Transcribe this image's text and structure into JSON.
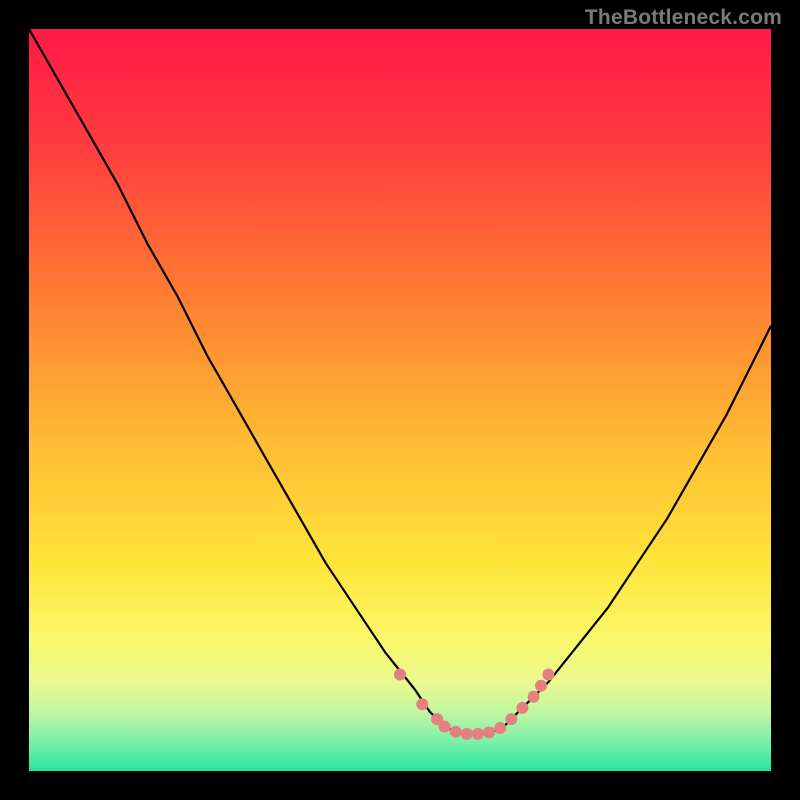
{
  "watermark": "TheBottleneck.com",
  "chart_data": {
    "type": "line",
    "title": "",
    "xlabel": "",
    "ylabel": "",
    "xlim": [
      0,
      100
    ],
    "ylim": [
      0,
      100
    ],
    "grid": false,
    "axes_visible": false,
    "background_gradient": {
      "stops": [
        {
          "offset": 0,
          "color": "#ff1a47"
        },
        {
          "offset": 15,
          "color": "#ff3a3f"
        },
        {
          "offset": 35,
          "color": "#ff7a33"
        },
        {
          "offset": 55,
          "color": "#ffb933"
        },
        {
          "offset": 72,
          "color": "#ffe43a"
        },
        {
          "offset": 82,
          "color": "#fbf86a"
        },
        {
          "offset": 88,
          "color": "#eaf98f"
        },
        {
          "offset": 92,
          "color": "#c1f7a0"
        },
        {
          "offset": 96,
          "color": "#7cf0ab"
        },
        {
          "offset": 100,
          "color": "#23e59e"
        }
      ]
    },
    "series": [
      {
        "name": "bottleneck-curve",
        "color": "#000000",
        "x": [
          0,
          4,
          8,
          12,
          16,
          20,
          24,
          28,
          32,
          36,
          40,
          44,
          48,
          52,
          54,
          56,
          58,
          60,
          62,
          64,
          66,
          70,
          74,
          78,
          82,
          86,
          90,
          94,
          98,
          100
        ],
        "y": [
          100,
          93,
          86,
          79,
          71,
          64,
          56,
          49,
          42,
          35,
          28,
          22,
          16,
          11,
          8,
          6,
          5,
          5,
          5,
          6,
          8,
          12,
          17,
          22,
          28,
          34,
          41,
          48,
          56,
          60
        ]
      }
    ],
    "markers": [
      {
        "name": "plateau-highlight",
        "shape": "circle",
        "color": "#e58080",
        "radius_px": 6,
        "points": [
          {
            "x": 50,
            "y": 13
          },
          {
            "x": 53,
            "y": 9
          },
          {
            "x": 55,
            "y": 7
          },
          {
            "x": 56,
            "y": 6
          },
          {
            "x": 57.5,
            "y": 5.3
          },
          {
            "x": 59,
            "y": 5
          },
          {
            "x": 60.5,
            "y": 5
          },
          {
            "x": 62,
            "y": 5.2
          },
          {
            "x": 63.5,
            "y": 5.8
          },
          {
            "x": 65,
            "y": 7
          },
          {
            "x": 66.5,
            "y": 8.5
          },
          {
            "x": 68,
            "y": 10
          },
          {
            "x": 69,
            "y": 11.5
          },
          {
            "x": 70,
            "y": 13
          }
        ]
      }
    ]
  }
}
